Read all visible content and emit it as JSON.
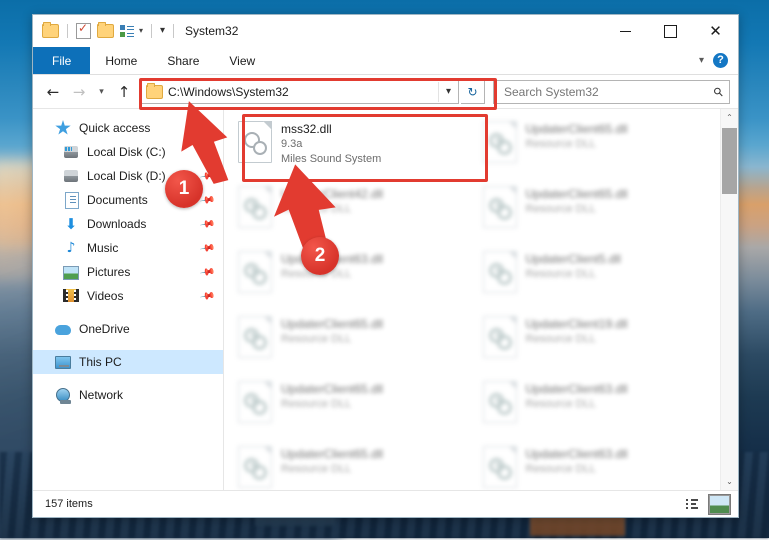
{
  "window": {
    "title": "System32",
    "quick_access_icons": [
      "folder-icon",
      "properties-icon",
      "new-folder-icon",
      "customize-list-icon"
    ],
    "controls": {
      "minimize": "–",
      "maximize": "□",
      "close": "✕"
    }
  },
  "ribbon": {
    "tabs": [
      {
        "label": "File",
        "active": true
      },
      {
        "label": "Home",
        "active": false
      },
      {
        "label": "Share",
        "active": false
      },
      {
        "label": "View",
        "active": false
      }
    ],
    "collapse_chevron": "⌄",
    "help_label": "?"
  },
  "addressbar": {
    "back": "←",
    "forward": "→",
    "recent": "⌄",
    "up": "↑",
    "path": "C:\\Windows\\System32",
    "dropdown_caret": "⌄",
    "refresh": "↻"
  },
  "search": {
    "placeholder": "Search System32",
    "value": "",
    "icon": "search-icon"
  },
  "sidebar": {
    "groups": [
      {
        "root": {
          "label": "Quick access",
          "icon": "star-icon",
          "pinned": false,
          "selected": false
        },
        "items": [
          {
            "label": "Local Disk (C:)",
            "icon": "drive-icon",
            "pinned": true
          },
          {
            "label": "Local Disk (D:)",
            "icon": "drive-icon",
            "pinned": true
          },
          {
            "label": "Documents",
            "icon": "documents-icon",
            "pinned": true
          },
          {
            "label": "Downloads",
            "icon": "downloads-icon",
            "pinned": true
          },
          {
            "label": "Music",
            "icon": "music-icon",
            "pinned": true
          },
          {
            "label": "Pictures",
            "icon": "pictures-icon",
            "pinned": true
          },
          {
            "label": "Videos",
            "icon": "videos-icon",
            "pinned": true
          }
        ]
      },
      {
        "root": {
          "label": "OneDrive",
          "icon": "cloud-icon",
          "pinned": false,
          "selected": false
        },
        "items": []
      },
      {
        "root": {
          "label": "This PC",
          "icon": "computer-icon",
          "pinned": false,
          "selected": true
        },
        "items": []
      },
      {
        "root": {
          "label": "Network",
          "icon": "network-icon",
          "pinned": false,
          "selected": false
        },
        "items": []
      }
    ]
  },
  "files": {
    "selected": {
      "name": "mss32.dll",
      "version": "9.3a",
      "description": "Miles Sound System",
      "icon": "dll-gear-icon"
    },
    "others": [
      {
        "name": "UpdaterClient65.dll",
        "description": "Resource DLL",
        "icon": "dll-puzzle-icon"
      },
      {
        "name": "UpdaterClient42.dll",
        "description": "Resource DLL",
        "icon": "dll-puzzle-icon"
      },
      {
        "name": "UpdaterClient65.dll",
        "description": "Resource DLL",
        "icon": "dll-puzzle-icon"
      },
      {
        "name": "UpdaterClient63.dll",
        "description": "Resource DLL",
        "icon": "dll-puzzle-icon"
      },
      {
        "name": "UpdaterClient5.dll",
        "description": "Resource DLL",
        "icon": "dll-puzzle-icon"
      },
      {
        "name": "UpdaterClient65.dll",
        "description": "Resource DLL",
        "icon": "dll-puzzle-icon"
      },
      {
        "name": "UpdaterClient19.dll",
        "description": "Resource DLL",
        "icon": "dll-puzzle-icon"
      },
      {
        "name": "UpdaterClient65.dll",
        "description": "Resource DLL",
        "icon": "dll-puzzle-icon"
      },
      {
        "name": "UpdaterClient63.dll",
        "description": "Resource DLL",
        "icon": "dll-puzzle-icon"
      },
      {
        "name": "UpdaterClient65.dll",
        "description": "Resource DLL",
        "icon": "dll-puzzle-icon"
      },
      {
        "name": "UpdaterClient63.dll",
        "description": "Resource DLL",
        "icon": "dll-puzzle-icon"
      }
    ]
  },
  "statusbar": {
    "item_count": "157 items",
    "view_details": "details-view-icon",
    "view_large": "large-icons-view-icon"
  },
  "annotations": {
    "badge_one": "1",
    "badge_two": "2",
    "highlight_color": "#e23b30"
  },
  "scrollbar": {
    "up_arrow": "⌃",
    "down_arrow": "⌄"
  }
}
